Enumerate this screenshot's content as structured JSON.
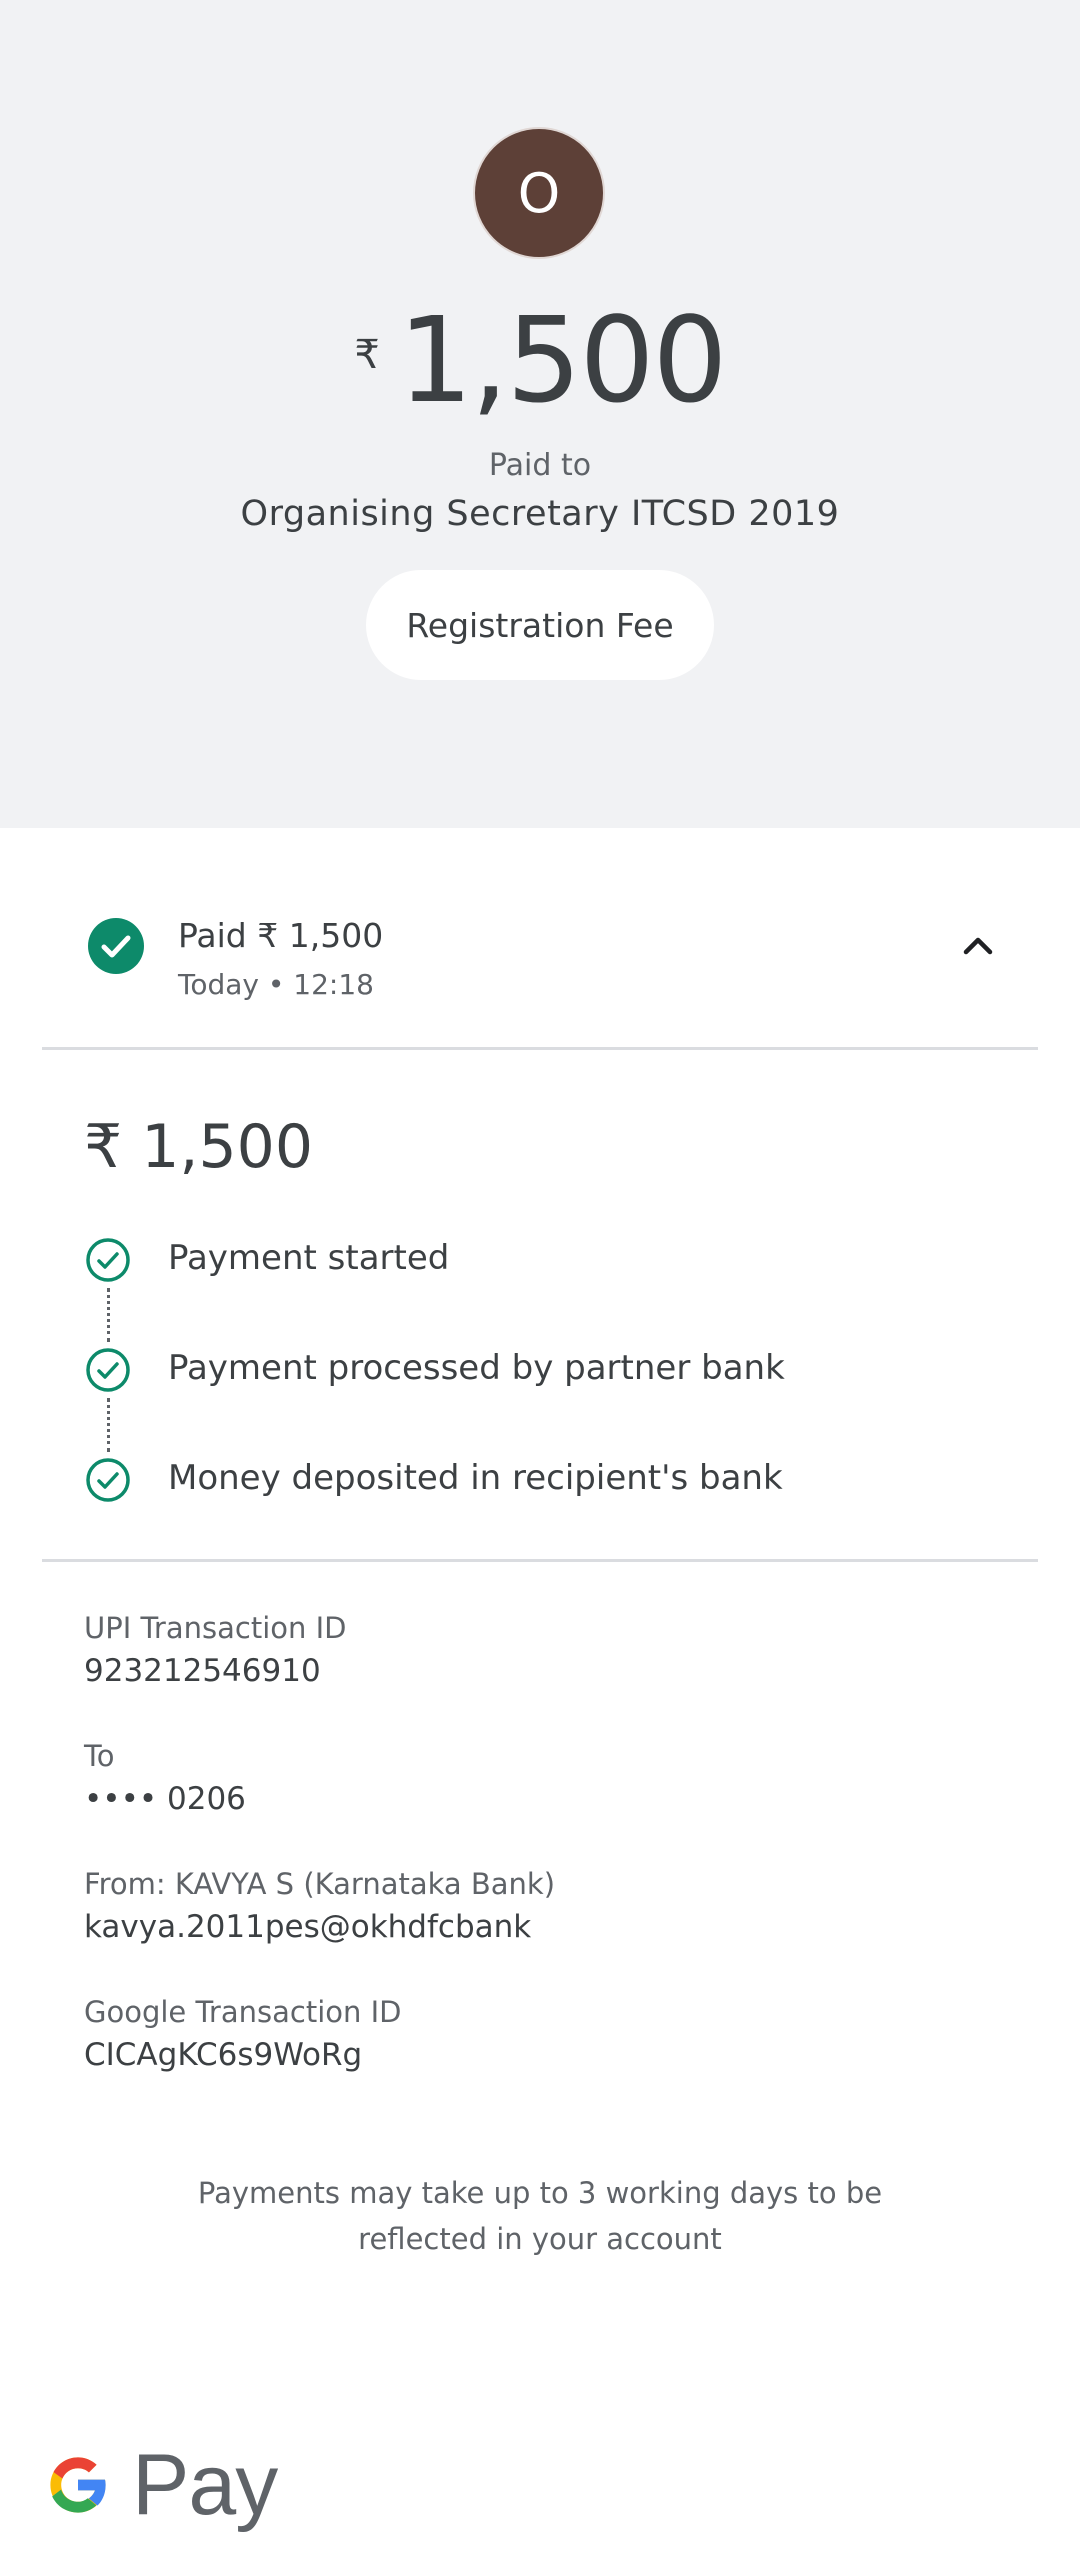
{
  "header": {
    "avatar_initial": "O",
    "currency_symbol": "₹",
    "amount": "1,500",
    "paid_to_label": "Paid to",
    "recipient_name": "Organising Secretary ITCSD 2019",
    "note": "Registration Fee"
  },
  "status": {
    "title": "Paid ₹ 1,500",
    "time": "Today • 12:18",
    "icon": "check-circle-icon",
    "expand_icon": "chevron-up-icon"
  },
  "details": {
    "amount": "₹ 1,500",
    "steps": [
      {
        "label": "Payment started"
      },
      {
        "label": "Payment processed by partner bank"
      },
      {
        "label": "Money deposited in recipient's bank"
      }
    ]
  },
  "info": {
    "upi_label": "UPI Transaction ID",
    "upi_value": "923212546910",
    "to_label": "To",
    "to_value": "•••• 0206",
    "from_label": "From: KAVYA S (Karnataka Bank)",
    "from_value": "kavya.2011pes@okhdfcbank",
    "google_label": "Google Transaction ID",
    "google_value": "CICAgKC6s9WoRg"
  },
  "footer": {
    "note": "Payments may take up to 3 working days to be reflected in your account",
    "brand": "Pay"
  },
  "colors": {
    "success": "#0d8a6a",
    "avatar_bg": "#5d4037",
    "top_bg": "#f1f2f4",
    "google_blue": "#4285F4",
    "google_red": "#EA4335",
    "google_yellow": "#FBBC05",
    "google_green": "#34A853"
  }
}
